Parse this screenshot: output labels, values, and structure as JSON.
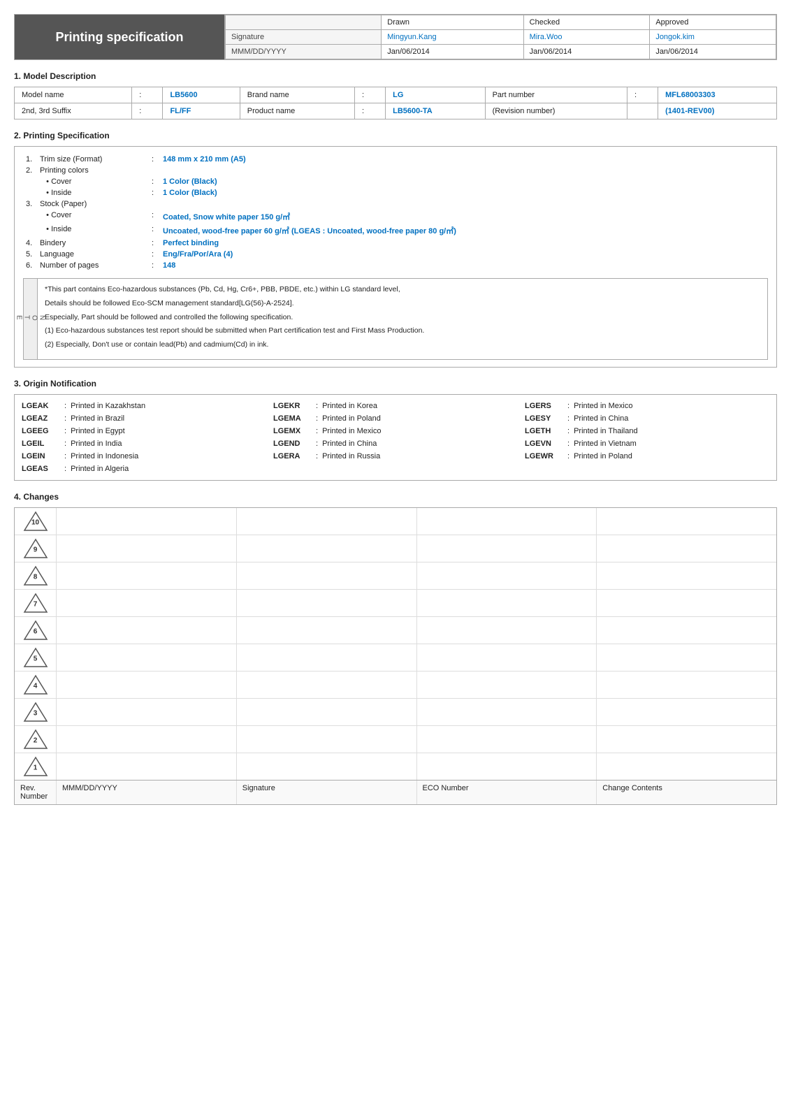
{
  "header": {
    "title": "Printing specification",
    "table": {
      "cols": [
        "",
        "Drawn",
        "Checked",
        "Approved"
      ],
      "rows": [
        [
          "Signature",
          "Mingyun.Kang",
          "Mira.Woo",
          "Jongok.kim"
        ],
        [
          "MMM/DD/YYYY",
          "Jan/06/2014",
          "Jan/06/2014",
          "Jan/06/2014"
        ]
      ]
    }
  },
  "model_description": {
    "title": "1. Model Description",
    "rows": [
      {
        "label1": "Model name",
        "val1": "LB5600",
        "label2": "Brand name",
        "val2": "LG",
        "label3": "Part number",
        "val3": "MFL68003303"
      },
      {
        "label1": "2nd, 3rd Suffix",
        "val1": "FL/FF",
        "label2": "Product name",
        "val2": "LB5600-TA",
        "label3": "(Revision number)",
        "val3": "(1401-REV00)"
      }
    ]
  },
  "printing_spec": {
    "title": "2. Printing Specification",
    "items": [
      {
        "num": "1.",
        "label": "Trim size (Format)",
        "colon": ":",
        "value": "148 mm x 210 mm (A5)",
        "blue": true
      },
      {
        "num": "2.",
        "label": "Printing colors",
        "colon": "",
        "value": "",
        "blue": false
      },
      {
        "num": "",
        "label": "  • Cover",
        "colon": ":",
        "value": "1 Color (Black)",
        "blue": true
      },
      {
        "num": "",
        "label": "  • Inside",
        "colon": ":",
        "value": "1 Color (Black)",
        "blue": true
      },
      {
        "num": "3.",
        "label": "Stock (Paper)",
        "colon": "",
        "value": "",
        "blue": false
      },
      {
        "num": "",
        "label": "  • Cover",
        "colon": ":",
        "value": "Coated, Snow white paper 150 g/㎡",
        "blue": true
      },
      {
        "num": "",
        "label": "  • Inside",
        "colon": ":",
        "value": "Uncoated, wood-free paper 60 g/㎡ (LGEAS : Uncoated, wood-free paper 80 g/㎡)",
        "blue": true
      },
      {
        "num": "4.",
        "label": "Bindery",
        "colon": ":",
        "value": "Perfect binding",
        "blue": true
      },
      {
        "num": "5.",
        "label": "Language",
        "colon": ":",
        "value": "Eng/Fra/Por/Ara (4)",
        "blue": true
      },
      {
        "num": "6.",
        "label": "Number of pages",
        "colon": ":",
        "value": "148",
        "blue": true
      }
    ]
  },
  "notes": {
    "side_label": "NOTE",
    "lines": [
      "*This part contains Eco-hazardous substances (Pb, Cd, Hg, Cr6+, PBB, PBDE, etc.) within LG standard level,",
      "Details should be followed Eco-SCM management standard[LG(56)-A-2524].",
      "Especially, Part should be followed and controlled the following specification.",
      "(1) Eco-hazardous substances test report should be submitted when Part certification test and First Mass Production.",
      "(2) Especially, Don't use or contain lead(Pb) and cadmium(Cd) in ink."
    ]
  },
  "origin": {
    "title": "3. Origin Notification",
    "items": [
      {
        "code": "LGEAK",
        "desc": "Printed in Kazakhstan"
      },
      {
        "code": "LGEKR",
        "desc": "Printed in Korea"
      },
      {
        "code": "LGERS",
        "desc": "Printed in Mexico"
      },
      {
        "code": "LGEAZ",
        "desc": "Printed in Brazil"
      },
      {
        "code": "LGEMA",
        "desc": "Printed in Poland"
      },
      {
        "code": "LGESY",
        "desc": "Printed in China"
      },
      {
        "code": "LGEEG",
        "desc": "Printed in Egypt"
      },
      {
        "code": "LGEMX",
        "desc": "Printed in Mexico"
      },
      {
        "code": "LGETH",
        "desc": "Printed in Thailand"
      },
      {
        "code": "LGEIL",
        "desc": "Printed in India"
      },
      {
        "code": "LGEND",
        "desc": "Printed in China"
      },
      {
        "code": "LGEVN",
        "desc": "Printed in Vietnam"
      },
      {
        "code": "LGEIN",
        "desc": "Printed in Indonesia"
      },
      {
        "code": "LGERA",
        "desc": "Printed in Russia"
      },
      {
        "code": "LGEWR",
        "desc": "Printed in Poland"
      },
      {
        "code": "LGEAS",
        "desc": "Printed in Algeria"
      },
      {
        "code": "",
        "desc": ""
      },
      {
        "code": "",
        "desc": ""
      }
    ]
  },
  "changes": {
    "title": "4. Changes",
    "revisions": [
      10,
      9,
      8,
      7,
      6,
      5,
      4,
      3,
      2,
      1
    ],
    "footer": {
      "col1": "Rev. Number",
      "col2": "MMM/DD/YYYY",
      "col3": "Signature",
      "col4": "ECO Number",
      "col5": "Change Contents"
    }
  }
}
